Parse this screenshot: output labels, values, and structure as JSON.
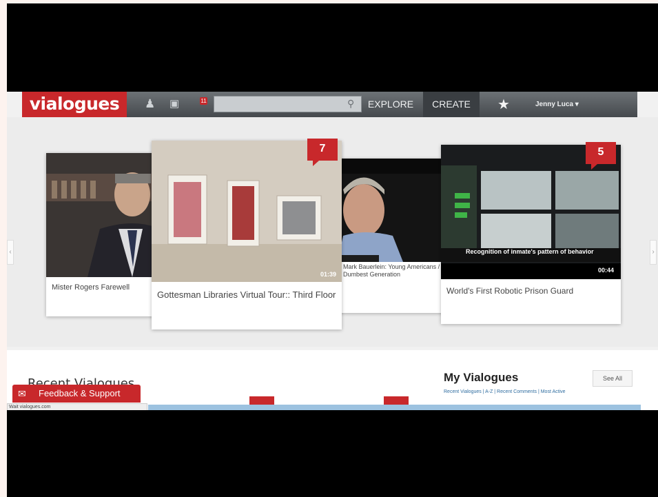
{
  "app": {
    "logo": "vialogues"
  },
  "topbar": {
    "notification_count": "11",
    "search_placeholder": "",
    "explore": "EXPLORE",
    "create": "CREATE",
    "user": "Jenny Luca ▾"
  },
  "carousel": [
    {
      "caption": "Mister Rogers Farewell"
    },
    {
      "caption": "Gottesman Libraries Virtual Tour:: Third Floor",
      "count": "7",
      "duration": "01:39"
    },
    {
      "caption": "Mark Bauerlein: Young Americans / Dumbest Generation"
    },
    {
      "caption": "World's First Robotic Prison Guard",
      "count": "5",
      "duration": "00:44",
      "subtitle": "Recognition of inmate's pattern of behavior"
    }
  ],
  "recent": {
    "title": "Recent Vialogues"
  },
  "my_vialogues": {
    "title": "My Vialogues",
    "see_all": "See All",
    "links": "Recent Vialogues | A-Z | Recent Comments | Most Active"
  },
  "feedback": {
    "label": "Feedback & Support"
  },
  "status": {
    "url": "Wait vialogues.com"
  },
  "colors": {
    "brand": "#c8282b",
    "nav": "#45494d"
  }
}
